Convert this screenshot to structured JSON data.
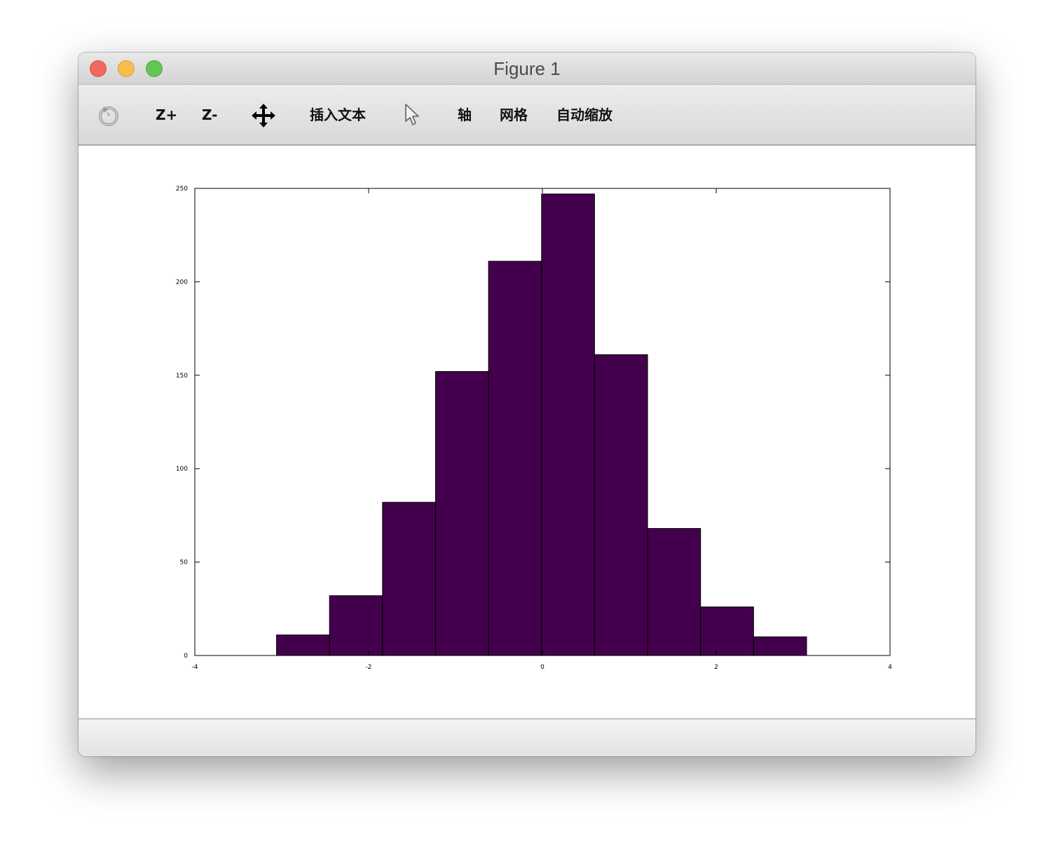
{
  "window": {
    "title": "Figure 1"
  },
  "toolbar": {
    "rotate_icon": "rotate-icon",
    "zoom_in_label": "Z+",
    "zoom_out_label": "Z-",
    "pan_icon": "move-arrows-icon",
    "insert_text_label": "插入文本",
    "select_icon": "pointer-arrow-icon",
    "axis_label": "轴",
    "grid_label": "网格",
    "autoscale_label": "自动缩放"
  },
  "colors": {
    "bar_fill": "#43004c",
    "bar_stroke": "#000000",
    "axis": "#000000"
  },
  "chart_data": {
    "type": "bar",
    "subtype": "histogram",
    "bin_edges": [
      -3.06,
      -2.45,
      -1.84,
      -1.23,
      -0.62,
      -0.01,
      0.6,
      1.21,
      1.82,
      2.43,
      3.04
    ],
    "values": [
      11,
      32,
      82,
      152,
      211,
      247,
      161,
      68,
      26,
      10
    ],
    "xlim": [
      -4,
      4
    ],
    "ylim": [
      0,
      250
    ],
    "x_ticks": [
      -4,
      -2,
      0,
      2,
      4
    ],
    "x_tick_labels": [
      "-4",
      "-2",
      "0",
      "2",
      "4"
    ],
    "y_ticks": [
      0,
      50,
      100,
      150,
      200,
      250
    ],
    "y_tick_labels": [
      "0",
      "50",
      "100",
      "150",
      "200",
      "250"
    ],
    "grid": false,
    "box": true,
    "legend": "none"
  }
}
